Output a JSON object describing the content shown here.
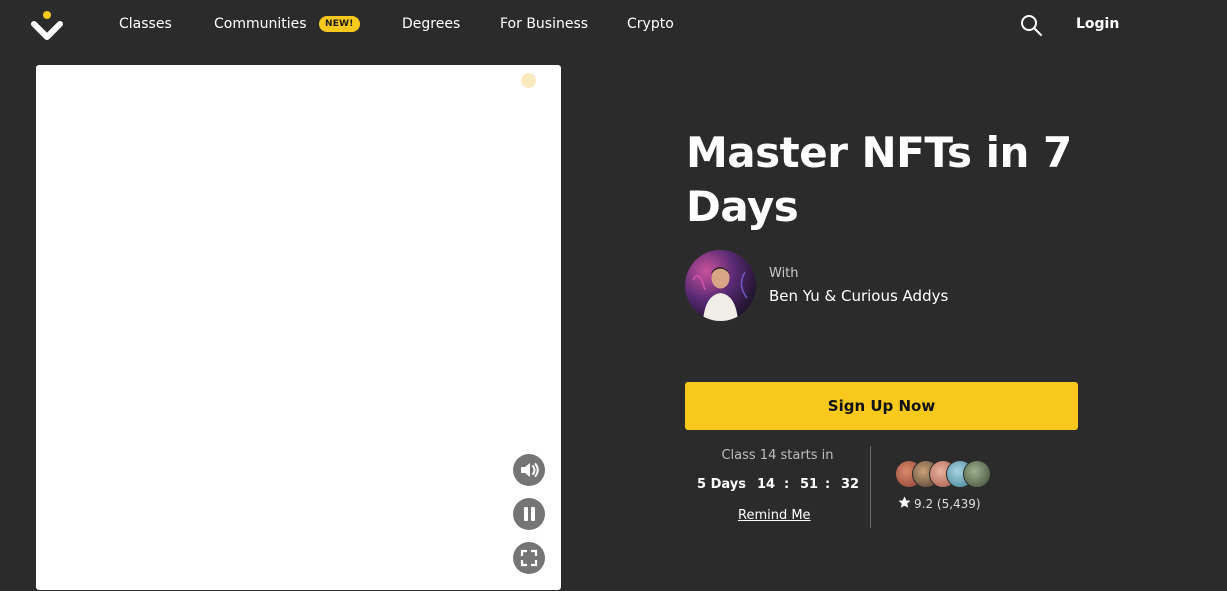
{
  "nav": {
    "items": [
      {
        "label": "Classes"
      },
      {
        "label": "Communities",
        "badge": "NEW!"
      },
      {
        "label": "Degrees"
      },
      {
        "label": "For Business"
      },
      {
        "label": "Crypto"
      }
    ],
    "login_label": "Login",
    "logo_icon": "brand-logo-icon",
    "search_icon": "search-icon"
  },
  "course": {
    "title": "Master NFTs in 7 Days",
    "with_label": "With",
    "instructors": "Ben Yu & Curious Addys",
    "signup_label": "Sign Up Now",
    "starts_text": "Class 14 starts in",
    "countdown": {
      "days": "5 Days",
      "hours": "14",
      "minutes": "51",
      "seconds": "32",
      "sep": ":"
    },
    "remind_label": "Remind Me",
    "rating": "9.2 (5,439)"
  },
  "video": {
    "controls": [
      "volume-icon",
      "pause-icon",
      "fullscreen-icon"
    ]
  },
  "colors": {
    "background": "#2b2b2b",
    "accent": "#f8c81c",
    "video_bg": "#ffffff"
  }
}
